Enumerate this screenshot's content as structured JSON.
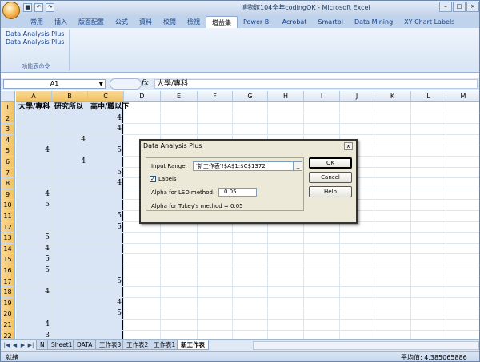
{
  "window": {
    "title": "博物館104全年codingOK - Microsoft Excel"
  },
  "ribbon": {
    "tabs": [
      "常用",
      "插入",
      "版面配置",
      "公式",
      "資料",
      "校閱",
      "檢視",
      "增益集",
      "Power BI",
      "Acrobat",
      "Smartbi",
      "Data Mining",
      "XY Chart Labels"
    ],
    "active_tab": "增益集",
    "group_items": [
      "Data Analysis Plus",
      "Data Analysis Plus"
    ],
    "group_label": "功能表命令"
  },
  "formula_bar": {
    "name_box": "A1",
    "fx": "fx",
    "content": "大學/專科"
  },
  "grid": {
    "columns": [
      "A",
      "B",
      "C",
      "D",
      "E",
      "F",
      "G",
      "H",
      "I",
      "J",
      "K",
      "L",
      "M"
    ],
    "rows": [
      "1",
      "2",
      "3",
      "4",
      "5",
      "6",
      "7",
      "8",
      "9",
      "10",
      "11",
      "12",
      "13",
      "14",
      "15",
      "16",
      "17",
      "18",
      "19",
      "20",
      "21",
      "22"
    ],
    "headers": {
      "A": "大學/專科",
      "B": "研究所以",
      "C": "高中/職以下"
    },
    "cells": [
      {
        "row": 2,
        "col": "C",
        "value": "4"
      },
      {
        "row": 3,
        "col": "C",
        "value": "4"
      },
      {
        "row": 4,
        "col": "B",
        "value": "4"
      },
      {
        "row": 5,
        "col": "A",
        "value": "4"
      },
      {
        "row": 5,
        "col": "C",
        "value": "5"
      },
      {
        "row": 6,
        "col": "B",
        "value": "4"
      },
      {
        "row": 7,
        "col": "C",
        "value": "5"
      },
      {
        "row": 8,
        "col": "C",
        "value": "4"
      },
      {
        "row": 9,
        "col": "A",
        "value": "4"
      },
      {
        "row": 10,
        "col": "A",
        "value": "5"
      },
      {
        "row": 11,
        "col": "C",
        "value": "5"
      },
      {
        "row": 12,
        "col": "C",
        "value": "5"
      },
      {
        "row": 13,
        "col": "A",
        "value": "5"
      },
      {
        "row": 14,
        "col": "A",
        "value": "4"
      },
      {
        "row": 15,
        "col": "A",
        "value": "5"
      },
      {
        "row": 16,
        "col": "A",
        "value": "5"
      },
      {
        "row": 17,
        "col": "C",
        "value": "5"
      },
      {
        "row": 18,
        "col": "A",
        "value": "4"
      },
      {
        "row": 19,
        "col": "C",
        "value": "4"
      },
      {
        "row": 20,
        "col": "C",
        "value": "5"
      },
      {
        "row": 21,
        "col": "A",
        "value": "4"
      },
      {
        "row": 22,
        "col": "A",
        "value": "3"
      }
    ]
  },
  "sheets": {
    "tabs": [
      "N",
      "Sheet1",
      "DATA",
      "工作表3",
      "工作表2",
      "工作表1",
      "新工作表"
    ],
    "active": "新工作表"
  },
  "status": {
    "ready": "就緒",
    "average": "平均值: 4.385065886"
  },
  "dialog": {
    "title": "Data Analysis Plus",
    "close": "x",
    "input_range_label": "Input Range:",
    "input_range_value": "'新工作表'!$A$1:$C$1372",
    "range_button": "_",
    "labels_checkbox": "Labels",
    "labels_checked": true,
    "lsd_label": "Alpha for LSD method:",
    "lsd_value": "0.05",
    "tukey_text": "Alpha for Tukey's method = 0.05",
    "ok": "OK",
    "cancel": "Cancel",
    "help": "Help"
  }
}
